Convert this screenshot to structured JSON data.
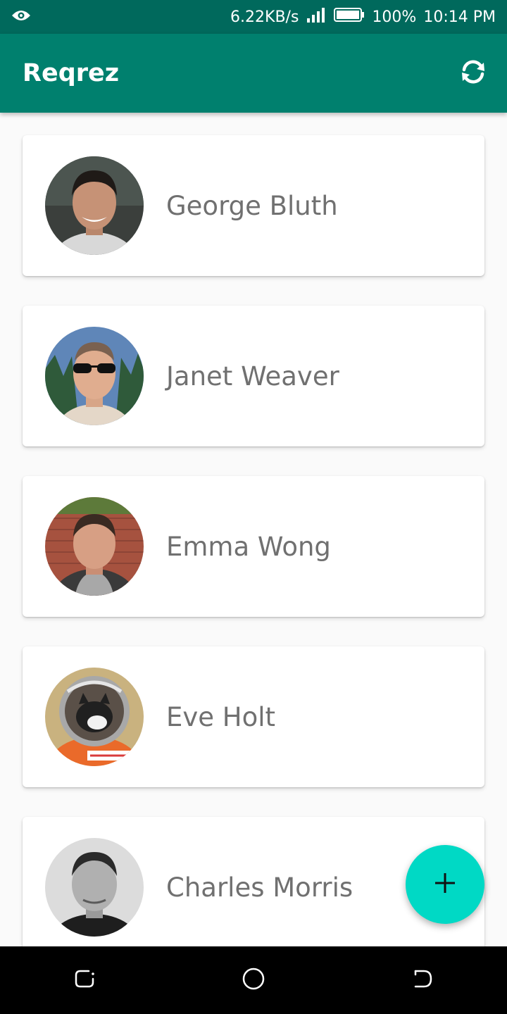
{
  "status_bar": {
    "network_speed": "6.22KB/s",
    "battery": "100%",
    "time": "10:14 PM",
    "icons": [
      "eye-icon",
      "signal-icon",
      "battery-icon"
    ]
  },
  "app_bar": {
    "title": "Reqrez",
    "action_icon": "refresh-icon"
  },
  "users": [
    {
      "name": "George Bluth"
    },
    {
      "name": "Janet Weaver"
    },
    {
      "name": "Emma Wong"
    },
    {
      "name": "Eve Holt"
    },
    {
      "name": "Charles Morris"
    }
  ],
  "fab": {
    "icon": "plus-icon"
  },
  "nav_bar": {
    "icons": [
      "recent-apps-icon",
      "home-icon",
      "back-icon"
    ]
  },
  "colors": {
    "status_bar": "#00695c",
    "app_bar": "#00806e",
    "fab": "#00d9c5",
    "name_text": "#707070"
  }
}
